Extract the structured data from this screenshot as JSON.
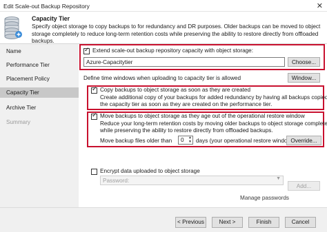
{
  "window": {
    "title": "Edit Scale-out Backup Repository",
    "close_glyph": "✕"
  },
  "header": {
    "title": "Capacity Tier",
    "description": "Specify object storage to copy backups to for redundancy and DR purposes. Older backups can be moved to object storage completely to reduce long-term retention costs while preserving the ability to restore directly from offloaded backups."
  },
  "sidebar": {
    "items": [
      {
        "label": "Name",
        "state": "normal"
      },
      {
        "label": "Performance Tier",
        "state": "normal"
      },
      {
        "label": "Placement Policy",
        "state": "normal"
      },
      {
        "label": "Capacity Tier",
        "state": "active"
      },
      {
        "label": "Archive Tier",
        "state": "normal"
      },
      {
        "label": "Summary",
        "state": "disabled"
      }
    ]
  },
  "main": {
    "extend": {
      "label": "Extend scale-out backup repository capacity with object storage:",
      "checked": true,
      "storage_value": "Azure-Capacitytier",
      "choose_label": "Choose..."
    },
    "time_windows": {
      "label": "Define time windows when uploading to capacity tier is allowed",
      "button": "Window..."
    },
    "copy": {
      "label": "Copy backups to object storage as soon as they are created",
      "checked": true,
      "desc_line1": "Create additional copy of your backups for added redundancy by having all backups copied to",
      "desc_line2": "the capacity tier as soon as they are created on the performance tier."
    },
    "move": {
      "label": "Move backups to object storage as they age out of the operational restore window",
      "checked": true,
      "desc_line1": "Reduce your long-term retention costs by moving older backups to object storage completely",
      "desc_line2": "while preserving the ability to restore directly from offloaded backups.",
      "older_prefix": "Move backup files older than",
      "days_value": "0",
      "older_suffix": "days (your operational restore window)",
      "override_label": "Override..."
    },
    "encrypt": {
      "label": "Encrypt data uploaded to object storage",
      "checked": false,
      "password_label": "Password:",
      "add_label": "Add...",
      "manage_label": "Manage passwords"
    }
  },
  "footer": {
    "previous": "< Previous",
    "next": "Next >",
    "finish": "Finish",
    "cancel": "Cancel"
  },
  "colors": {
    "highlight_border": "#c8102e",
    "active_nav": "#c8c8c8"
  }
}
